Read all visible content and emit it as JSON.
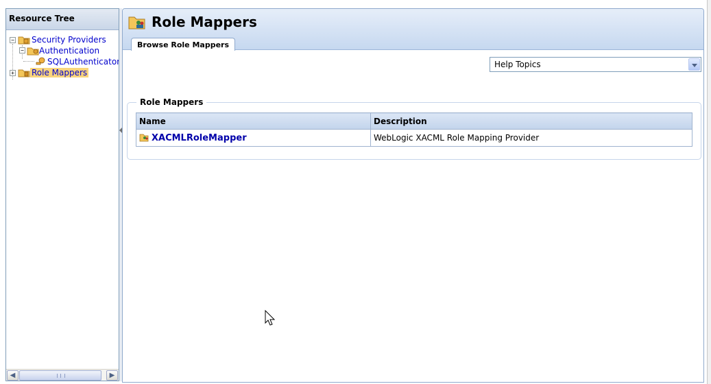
{
  "resource_tree": {
    "title": "Resource Tree",
    "nodes": [
      {
        "label": "Security Providers",
        "expander": "−"
      },
      {
        "label": "Authentication",
        "expander": "−"
      },
      {
        "label": "SQLAuthenticator"
      },
      {
        "label": "Role Mappers",
        "expander": "+",
        "selected": true
      }
    ]
  },
  "main": {
    "title": "Role Mappers",
    "tab_label": "Browse Role Mappers",
    "help_select": {
      "selected": "Help Topics"
    },
    "section": {
      "legend": "Role Mappers",
      "columns": [
        "Name",
        "Description"
      ],
      "rows": [
        {
          "name": "XACMLRoleMapper",
          "description": "WebLogic XACML Role Mapping Provider"
        }
      ]
    }
  },
  "colors": {
    "link": "#0000aa",
    "selection": "#f9d47c",
    "header_blue": "#c6d8f0",
    "border_blue": "#8fa9cc"
  },
  "icons": [
    "folder-icon",
    "key-icon",
    "role-mapper-icon",
    "mouse-cursor-icon"
  ]
}
